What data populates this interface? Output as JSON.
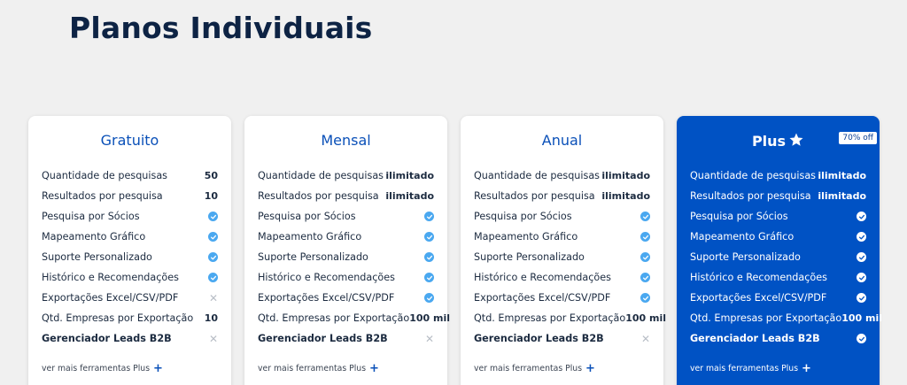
{
  "title": "Planos Individuais",
  "plans": [
    {
      "name": "Gratuito",
      "rows": [
        {
          "label": "Quantidade de pesquisas",
          "type": "value",
          "value": "50"
        },
        {
          "label": "Resultados por pesquisa",
          "type": "value",
          "value": "10"
        },
        {
          "label": "Pesquisa por Sócios",
          "type": "check"
        },
        {
          "label": "Mapeamento Gráfico",
          "type": "check"
        },
        {
          "label": "Suporte Personalizado",
          "type": "check"
        },
        {
          "label": "Histórico e Recomendações",
          "type": "check"
        },
        {
          "label": "Exportações Excel/CSV/PDF",
          "type": "cross"
        },
        {
          "label": "Qtd. Empresas por Exportação",
          "type": "value",
          "value": "10"
        },
        {
          "label": "Gerenciador Leads B2B",
          "type": "cross",
          "bold": true
        }
      ],
      "more": "ver mais ferramentas Plus"
    },
    {
      "name": "Mensal",
      "rows": [
        {
          "label": "Quantidade de pesquisas",
          "type": "value",
          "value": "ilimitado"
        },
        {
          "label": "Resultados por pesquisa",
          "type": "value",
          "value": "ilimitado"
        },
        {
          "label": "Pesquisa por Sócios",
          "type": "check"
        },
        {
          "label": "Mapeamento Gráfico",
          "type": "check"
        },
        {
          "label": "Suporte Personalizado",
          "type": "check"
        },
        {
          "label": "Histórico e Recomendações",
          "type": "check"
        },
        {
          "label": "Exportações Excel/CSV/PDF",
          "type": "check"
        },
        {
          "label": "Qtd. Empresas por Exportação",
          "type": "value",
          "value": "100 mil"
        },
        {
          "label": "Gerenciador Leads B2B",
          "type": "cross",
          "bold": true
        }
      ],
      "more": "ver mais ferramentas Plus"
    },
    {
      "name": "Anual",
      "rows": [
        {
          "label": "Quantidade de pesquisas",
          "type": "value",
          "value": "ilimitado"
        },
        {
          "label": "Resultados por pesquisa",
          "type": "value",
          "value": "ilimitado"
        },
        {
          "label": "Pesquisa por Sócios",
          "type": "check"
        },
        {
          "label": "Mapeamento Gráfico",
          "type": "check"
        },
        {
          "label": "Suporte Personalizado",
          "type": "check"
        },
        {
          "label": "Histórico e Recomendações",
          "type": "check"
        },
        {
          "label": "Exportações Excel/CSV/PDF",
          "type": "check"
        },
        {
          "label": "Qtd. Empresas por Exportação",
          "type": "value",
          "value": "100 mil"
        },
        {
          "label": "Gerenciador Leads B2B",
          "type": "cross",
          "bold": true
        }
      ],
      "more": "ver mais ferramentas Plus"
    },
    {
      "name": "Plus",
      "badge": "70% off",
      "rows": [
        {
          "label": "Quantidade de pesquisas",
          "type": "value",
          "value": "ilimitado"
        },
        {
          "label": "Resultados por pesquisa",
          "type": "value",
          "value": "ilimitado"
        },
        {
          "label": "Pesquisa por Sócios",
          "type": "check"
        },
        {
          "label": "Mapeamento Gráfico",
          "type": "check"
        },
        {
          "label": "Suporte Personalizado",
          "type": "check"
        },
        {
          "label": "Histórico e Recomendações",
          "type": "check"
        },
        {
          "label": "Exportações Excel/CSV/PDF",
          "type": "check"
        },
        {
          "label": "Qtd. Empresas por Exportação",
          "type": "value",
          "value": "100 mil"
        },
        {
          "label": "Gerenciador Leads B2B",
          "type": "check",
          "bold": true
        }
      ],
      "more": "ver mais ferramentas Plus"
    }
  ],
  "colors": {
    "accent": "#0a50b8",
    "plus_bg": "#0052c4",
    "check": "#4aa8f0",
    "title": "#0d2344"
  },
  "icons": {
    "check": "check-circle-icon",
    "cross": "close-icon",
    "star": "star-icon",
    "more": "plus-icon"
  }
}
